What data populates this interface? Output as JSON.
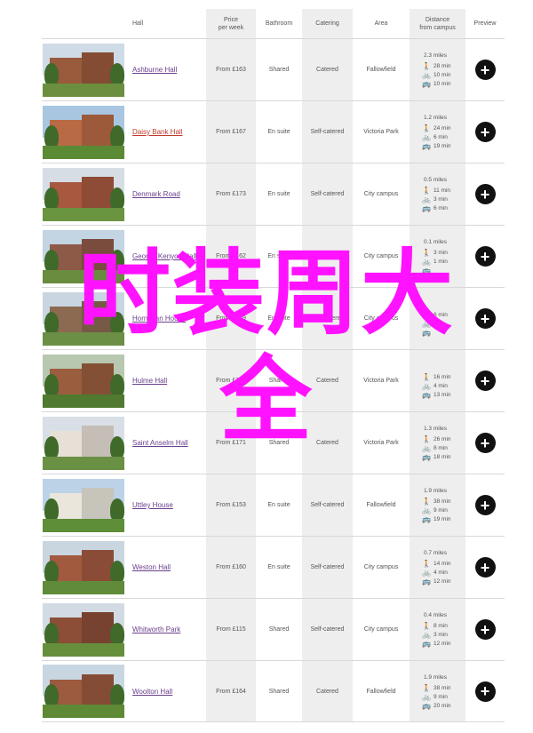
{
  "header": {
    "hall": "Hall",
    "price_line1": "Price",
    "price_line2": "per week",
    "bathroom": "Bathroom",
    "catering": "Catering",
    "area": "Area",
    "distance_line1": "Distance",
    "distance_line2": "from campus",
    "preview": "Preview"
  },
  "rows": [
    {
      "name": "Ashburne Hall",
      "price": "From £163",
      "bathroom": "Shared",
      "catering": "Catered",
      "area": "Fallowfield",
      "total": "2.3 miles",
      "walk": "28 min",
      "cycle": "10 min",
      "bus": "10 min",
      "palette": [
        "#cfdbe6",
        "#9a5a3c",
        "#6b8f3e"
      ]
    },
    {
      "name": "Daisy Bank Hall",
      "price": "From £167",
      "bathroom": "En suite",
      "catering": "Self-catered",
      "area": "Victoria Park",
      "total": "1.2 miles",
      "walk": "24 min",
      "cycle": "6 min",
      "bus": "19 min",
      "palette": [
        "#a9c6e0",
        "#b86a45",
        "#5b8a35"
      ]
    },
    {
      "name": "Denmark Road",
      "price": "From £173",
      "bathroom": "En suite",
      "catering": "Self-catered",
      "area": "City campus",
      "total": "0.5 miles",
      "walk": "11 min",
      "cycle": "3 min",
      "bus": "6 min",
      "palette": [
        "#d6dde4",
        "#a7583f",
        "#6a9440"
      ]
    },
    {
      "name": "George Kenyon Hall",
      "price": "From £162",
      "bathroom": "En suite",
      "catering": "Self-catered",
      "area": "City campus",
      "total": "0.1 miles",
      "walk": "3 min",
      "cycle": "1 min",
      "bus": "",
      "palette": [
        "#c3d4e3",
        "#8e5a48",
        "#6a8c3e"
      ]
    },
    {
      "name": "Horniman House",
      "price": "From £219",
      "bathroom": "En suite",
      "catering": "Self-catered",
      "area": "City campus",
      "total": "",
      "walk": "6 min",
      "cycle": "",
      "bus": "",
      "palette": [
        "#c9d6e2",
        "#8c6a52",
        "#6b8f45"
      ]
    },
    {
      "name": "Hulme Hall",
      "price": "From £174",
      "bathroom": "Shared",
      "catering": "Catered",
      "area": "Victoria Park",
      "total": "",
      "walk": "16 min",
      "cycle": "4 min",
      "bus": "13 min",
      "palette": [
        "#b8c8b0",
        "#9a5e3e",
        "#4f7a30"
      ]
    },
    {
      "name": "Saint Anselm Hall",
      "price": "From £171",
      "bathroom": "Shared",
      "catering": "Catered",
      "area": "Victoria Park",
      "total": "1.3 miles",
      "walk": "26 min",
      "cycle": "8 min",
      "bus": "18 min",
      "palette": [
        "#d8dfe6",
        "#e6e0d6",
        "#6a9043"
      ]
    },
    {
      "name": "Uttley House",
      "price": "From £153",
      "bathroom": "En suite",
      "catering": "Self-catered",
      "area": "Fallowfield",
      "total": "1.9 miles",
      "walk": "38 min",
      "cycle": "9 min",
      "bus": "19 min",
      "palette": [
        "#bcd2e6",
        "#eae6dc",
        "#5e8e38"
      ]
    },
    {
      "name": "Weston Hall",
      "price": "From £160",
      "bathroom": "En suite",
      "catering": "Self-catered",
      "area": "City campus",
      "total": "0.7 miles",
      "walk": "14 min",
      "cycle": "4 min",
      "bus": "12 min",
      "palette": [
        "#c9d6e0",
        "#a25a3f",
        "#5f8b3a"
      ]
    },
    {
      "name": "Whitworth Park",
      "price": "From £115",
      "bathroom": "Shared",
      "catering": "Self-catered",
      "area": "City campus",
      "total": "0.4 miles",
      "walk": "8 min",
      "cycle": "3 min",
      "bus": "12 min",
      "palette": [
        "#d2dbe3",
        "#8c4e37",
        "#668f3c"
      ]
    },
    {
      "name": "Woolton Hall",
      "price": "From £164",
      "bathroom": "Shared",
      "catering": "Catered",
      "area": "Fallowfield",
      "total": "1.9 miles",
      "walk": "38 min",
      "cycle": "9 min",
      "bus": "20 min",
      "palette": [
        "#c8d6e2",
        "#9c5a3e",
        "#5e8a36"
      ]
    }
  ],
  "icons": {
    "walk": "walking-person-icon",
    "cycle": "bicycle-icon",
    "bus": "bus-icon",
    "preview": "plus-circle-icon"
  },
  "watermark": {
    "line1": "时装周大",
    "line2": "全"
  },
  "colors": {
    "link": "#6a3f8c",
    "active_link": "#c0392b",
    "shade": "#eeeeee",
    "watermark": "#ff12ff"
  }
}
